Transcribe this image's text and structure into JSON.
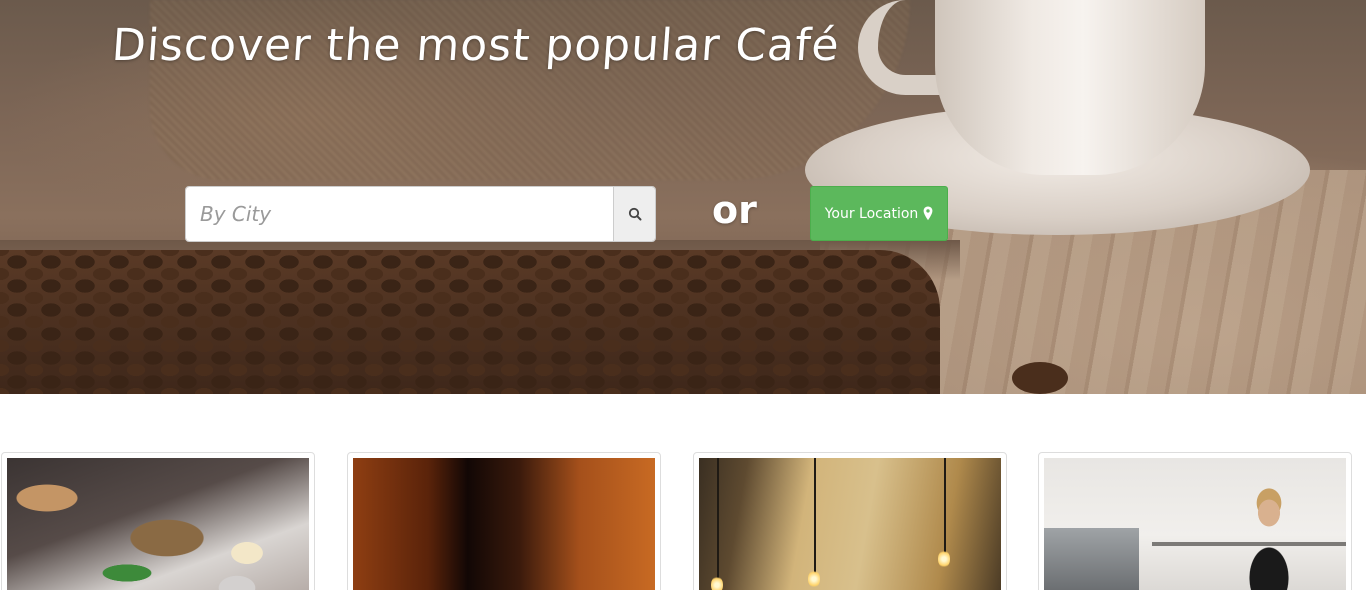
{
  "hero": {
    "title": "Discover the most popular Café",
    "search": {
      "placeholder": "By City",
      "value": "",
      "button_icon": "search-icon"
    },
    "or_label": "or",
    "location_button": {
      "label": "Your Location",
      "icon": "map-marker-icon"
    }
  },
  "colors": {
    "location_button": "#5cb85c",
    "search_button_bg": "#eeeeee",
    "hero_text": "#ffffff"
  },
  "cards": [
    {
      "image": "food-plate-photo"
    },
    {
      "image": "dark-cafe-photo"
    },
    {
      "image": "cafe-interior-photo"
    },
    {
      "image": "barista-photo"
    }
  ]
}
